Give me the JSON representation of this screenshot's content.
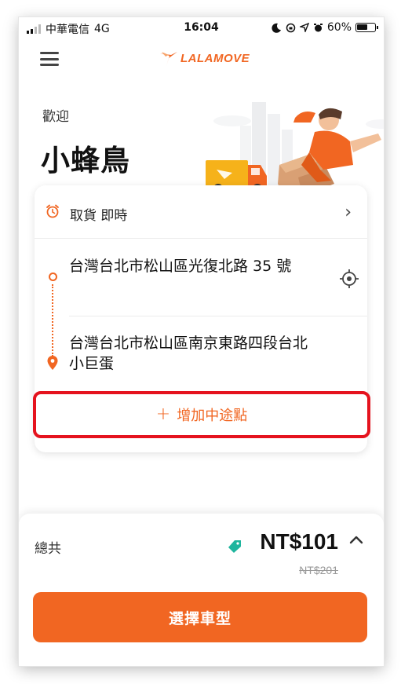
{
  "status_bar": {
    "carrier": "中華電信",
    "network": "4G",
    "time": "16:04",
    "battery": "60%"
  },
  "header": {
    "logo_text": "LALAMOVE",
    "menu_icon": "hamburger-menu-icon"
  },
  "greeting": {
    "welcome": "歡迎",
    "name": "小蜂鳥"
  },
  "pickup": {
    "label": "取貨 即時",
    "icon": "alarm-clock-icon"
  },
  "route": {
    "stops": [
      {
        "address": "台灣台北市松山區光復北路 35 號"
      },
      {
        "address": "台灣台北市松山區南京東路四段台北小巨蛋"
      }
    ],
    "add_stop_label": "增加中途點"
  },
  "footer": {
    "total_label": "總共",
    "price": "NT$101",
    "original_price": "NT$201",
    "select_vehicle_label": "選擇車型"
  },
  "colors": {
    "accent": "#f16622",
    "highlight_border": "#e5131e",
    "tag": "#1fb59e"
  }
}
